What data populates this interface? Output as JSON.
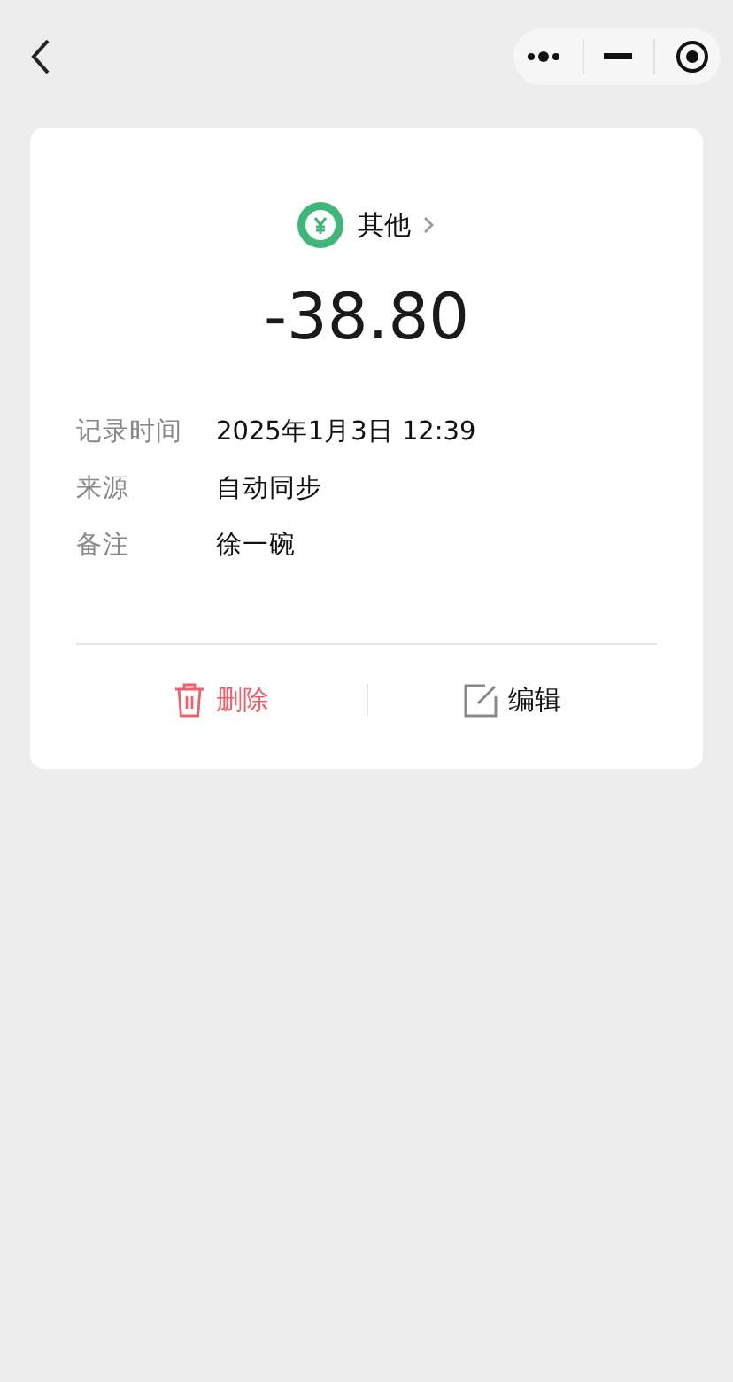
{
  "category": {
    "label": "其他"
  },
  "amount": "-38.80",
  "details": [
    {
      "label": "记录时间",
      "value": "2025年1月3日 12:39"
    },
    {
      "label": "来源",
      "value": "自动同步"
    },
    {
      "label": "备注",
      "value": "徐一碗"
    }
  ],
  "actions": [
    {
      "kind": "delete",
      "label": "删除"
    },
    {
      "kind": "edit",
      "label": "编辑"
    }
  ]
}
